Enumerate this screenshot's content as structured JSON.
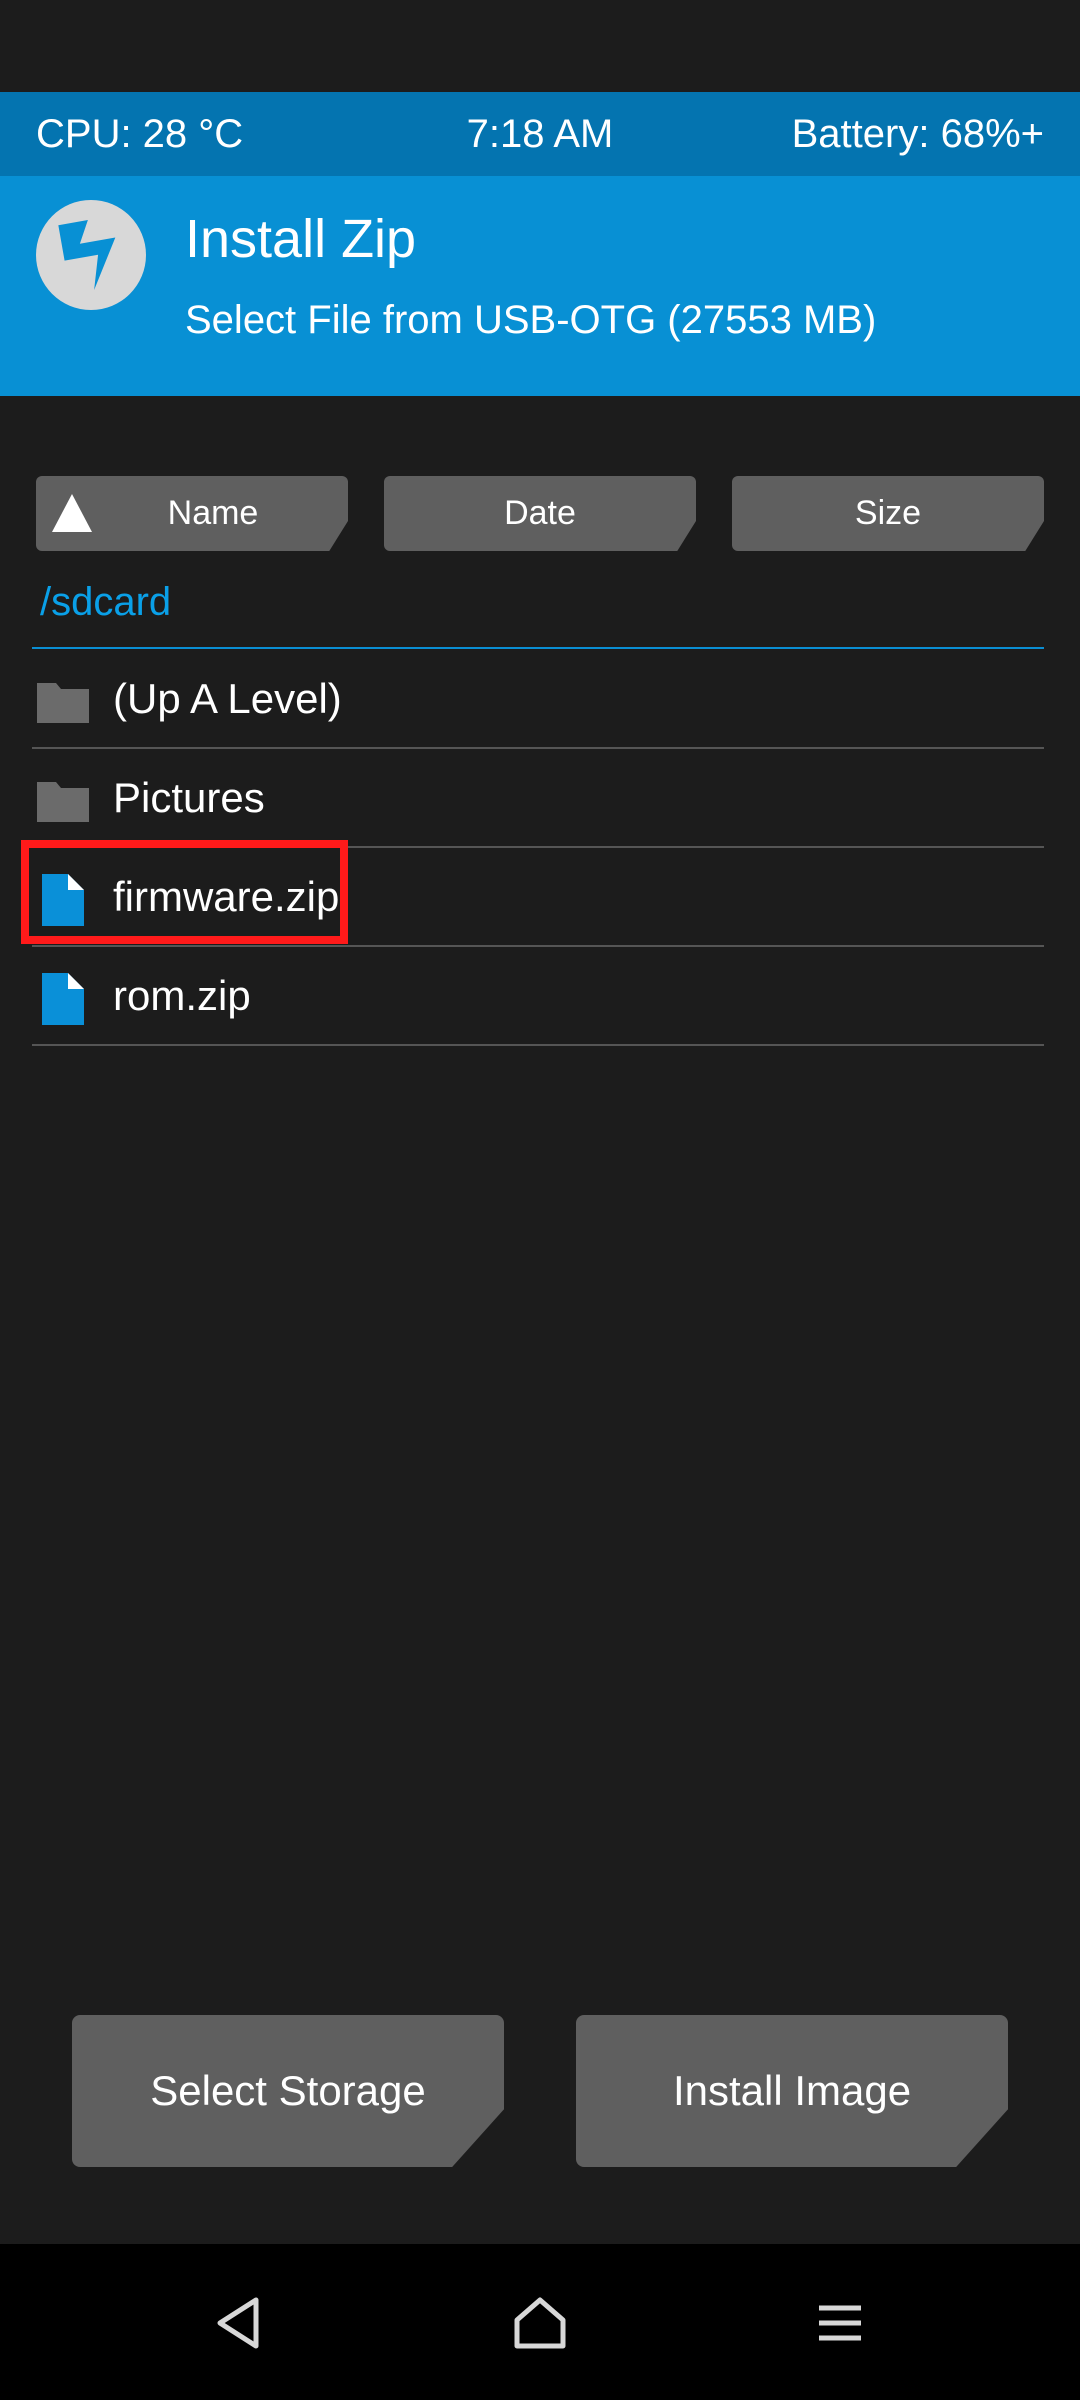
{
  "status": {
    "cpu": "CPU: 28 °C",
    "time": "7:18 AM",
    "battery": "Battery: 68%+"
  },
  "header": {
    "title": "Install Zip",
    "subtitle": "Select File from USB-OTG (27553 MB)",
    "logo_icon": "twrp-logo-icon"
  },
  "sort": {
    "name_label": "Name",
    "date_label": "Date",
    "size_label": "Size",
    "active_sort": "Name"
  },
  "path": "/sdcard",
  "files": [
    {
      "name": "(Up A Level)",
      "icon": "folder-icon"
    },
    {
      "name": "Pictures",
      "icon": "folder-icon"
    },
    {
      "name": "firmware.zip",
      "icon": "file-icon"
    },
    {
      "name": "rom.zip",
      "icon": "file-icon"
    }
  ],
  "actions": {
    "select_storage": "Select Storage",
    "install_image": "Install Image"
  },
  "nav": {
    "back_icon": "back-icon",
    "home_icon": "home-icon",
    "menu_icon": "menu-icon"
  },
  "colors": {
    "status_bar": "#0474b0",
    "header": "#0890d4",
    "accent": "#0aa0e8",
    "background": "#1c1c1c",
    "button": "#5f5f5f",
    "highlight": "#ff1a1a"
  }
}
